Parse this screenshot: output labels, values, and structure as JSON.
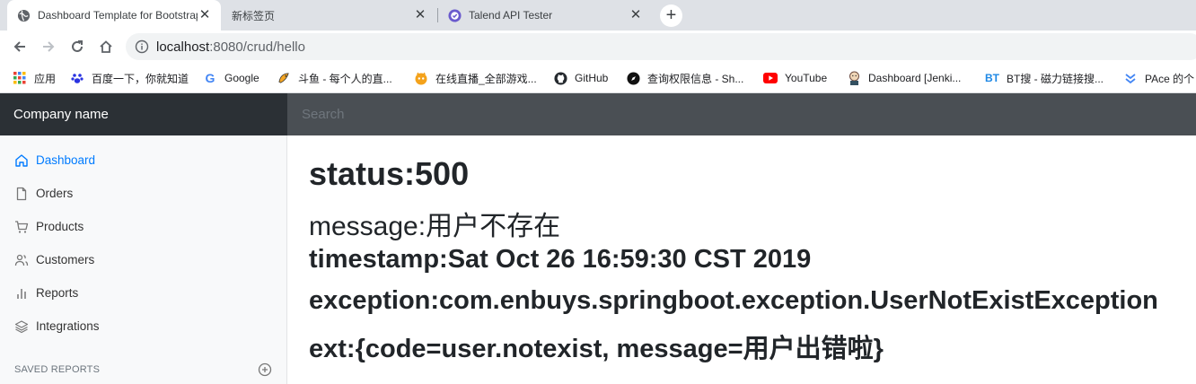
{
  "browser": {
    "tabs": [
      {
        "title": "Dashboard Template for Bootstrap",
        "favicon": "globe-icon",
        "active": true
      },
      {
        "title": "新标签页",
        "favicon": "none",
        "active": false
      },
      {
        "title": "Talend API Tester",
        "favicon": "talend-icon",
        "active": false
      }
    ],
    "new_tab_label": "+",
    "close_label": "✕",
    "url_host": "localhost",
    "url_path": ":8080/crud/hello"
  },
  "bookmarks": [
    {
      "label": "应用",
      "icon": "apps-grid-icon"
    },
    {
      "label": "百度一下，你就知道",
      "icon": "baidu-paw-icon"
    },
    {
      "label": "Google",
      "icon": "google-g-icon"
    },
    {
      "label": "斗鱼 - 每个人的直...",
      "icon": "douyu-icon"
    },
    {
      "label": "在线直播_全部游戏...",
      "icon": "huya-icon"
    },
    {
      "label": "GitHub",
      "icon": "github-icon"
    },
    {
      "label": "查询权限信息 - Sh...",
      "icon": "compass-icon"
    },
    {
      "label": "YouTube",
      "icon": "youtube-icon"
    },
    {
      "label": "Dashboard [Jenki...",
      "icon": "jenkins-icon"
    },
    {
      "label": "BT搜 - 磁力链接搜...",
      "icon": "bt-icon"
    },
    {
      "label": "PAce 的个",
      "icon": "chevrons-icon"
    }
  ],
  "navbar": {
    "brand": "Company name",
    "search_placeholder": "Search"
  },
  "sidebar": {
    "items": [
      {
        "label": "Dashboard",
        "icon": "home-icon",
        "active": true
      },
      {
        "label": "Orders",
        "icon": "file-icon",
        "active": false
      },
      {
        "label": "Products",
        "icon": "shopping-cart-icon",
        "active": false
      },
      {
        "label": "Customers",
        "icon": "users-icon",
        "active": false
      },
      {
        "label": "Reports",
        "icon": "bar-chart-icon",
        "active": false
      },
      {
        "label": "Integrations",
        "icon": "layers-icon",
        "active": false
      }
    ],
    "saved_reports_heading": "SAVED REPORTS"
  },
  "error": {
    "status": "status:500",
    "message": "message:用户不存在",
    "timestamp": "timestamp:Sat Oct 26 16:59:30 CST 2019",
    "exception": "exception:com.enbuys.springboot.exception.UserNotExistException",
    "ext": "ext:{code=user.notexist, message=用户出错啦}"
  },
  "colors": {
    "navbar": "#343a40",
    "brand_bg": "#2b3035",
    "active_link": "#007bff",
    "sidebar_bg": "#f8f9fa"
  }
}
